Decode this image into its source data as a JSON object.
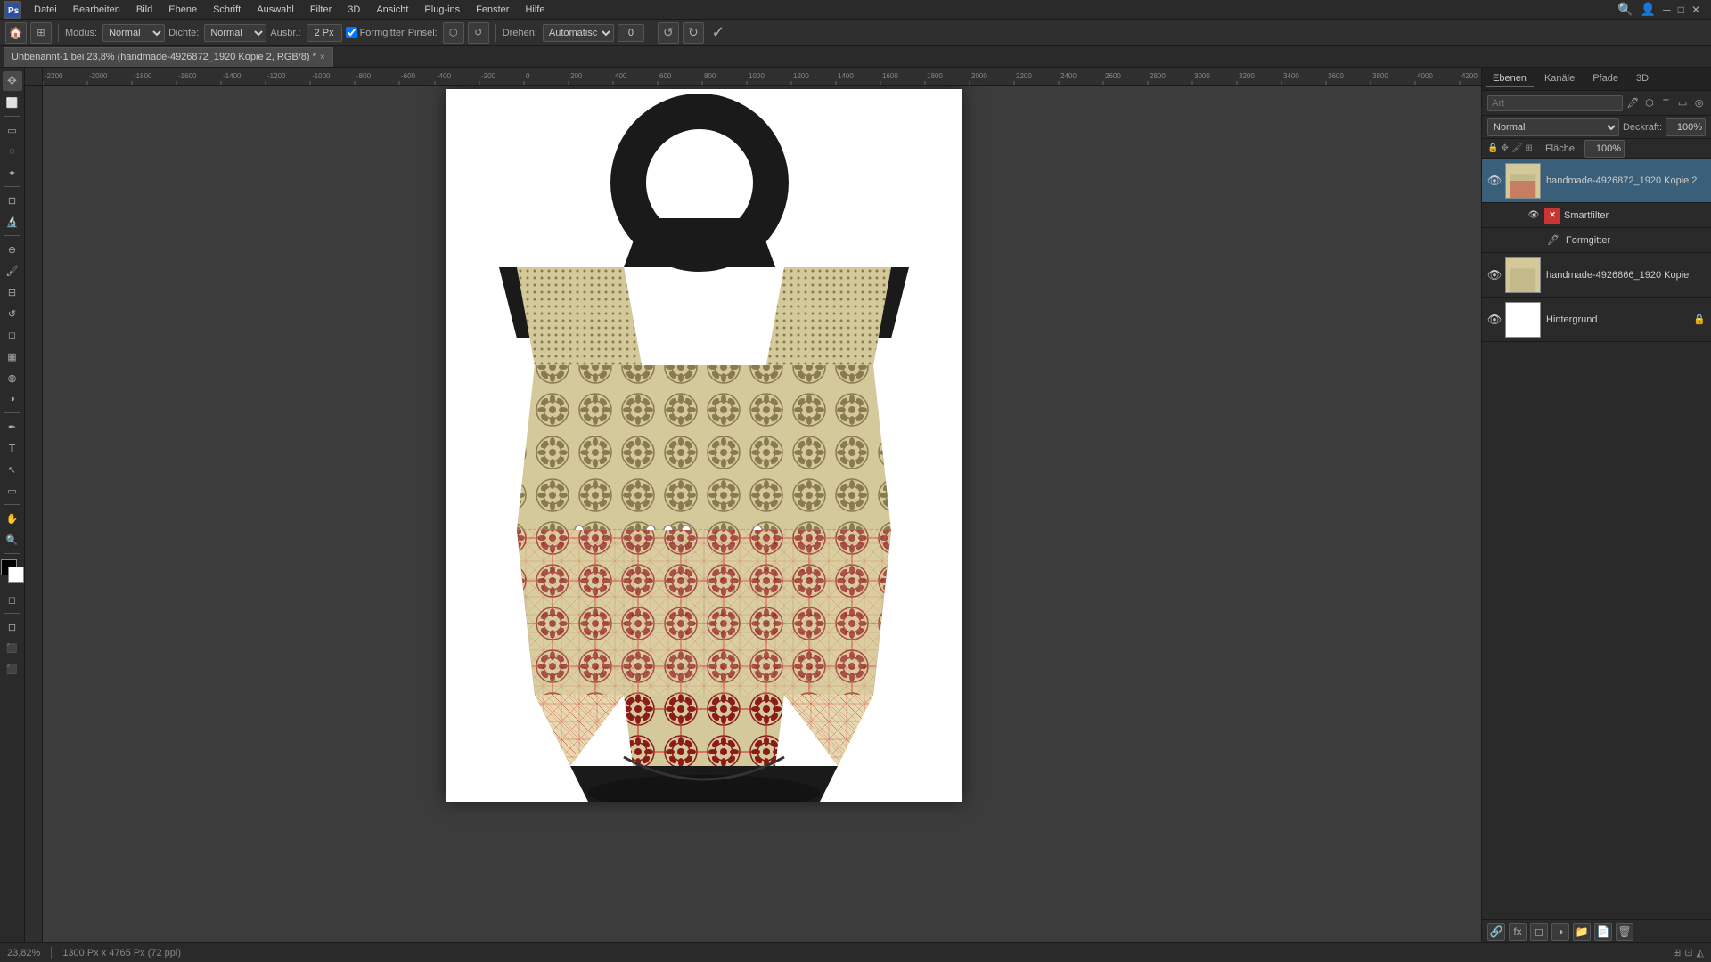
{
  "app": {
    "title": "Adobe Photoshop"
  },
  "menubar": {
    "items": [
      "Datei",
      "Bearbeiten",
      "Bild",
      "Ebene",
      "Schrift",
      "Auswahl",
      "Filter",
      "3D",
      "Ansicht",
      "Plug-ins",
      "Fenster",
      "Hilfe"
    ]
  },
  "toolbar": {
    "modus_label": "Modus:",
    "modus_value": "Normal",
    "dichte_label": "Dichte:",
    "dichte_value": "Normal",
    "ausbr_label": "Ausbr.:",
    "ausbr_value": "2 Px",
    "formgitter_label": "Formgitter",
    "pinsel_label": "Pinsel:",
    "drehen_label": "Drehen:",
    "drehen_value": "Automatisch",
    "angle_value": "0",
    "cancel_label": "↩",
    "confirm_label": "✓"
  },
  "tab": {
    "label": "Unbenannt-1 bei 23,8% (handmade-4926872_1920 Kopie 2, RGB/8) *",
    "close": "×"
  },
  "canvas": {
    "zoom": "23,82%",
    "size": "1300 Px x 4765 Px (72 ppi)"
  },
  "ruler": {
    "h_ticks": [
      "-2200",
      "-2000",
      "-1800",
      "-1600",
      "-1400",
      "-1200",
      "-1000",
      "-800",
      "-600",
      "-400",
      "-200",
      "0",
      "200",
      "400",
      "600",
      "800",
      "1000",
      "1200",
      "1400",
      "1600",
      "1800",
      "2000",
      "2200",
      "2400",
      "2600",
      "2800",
      "3000",
      "3200",
      "3400",
      "3600",
      "3800",
      "4000",
      "4200"
    ],
    "v_ticks": []
  },
  "right_panel": {
    "tabs": [
      "Ebenen",
      "Kanäle",
      "Pfade",
      "3D"
    ],
    "search_placeholder": "Art",
    "layer_mode": "Normal",
    "opacity_label": "Deckraft:",
    "opacity_value": "100%",
    "fill_label": "Fläche:",
    "fill_value": "100%",
    "layers": [
      {
        "id": "layer1",
        "name": "handmade-4926872_1920 Kopie 2",
        "visible": true,
        "selected": true,
        "has_lock": false,
        "thumb_bg": "#a8854a",
        "sub_layers": [
          {
            "id": "sl1",
            "name": "Smartfilter",
            "icon": "×"
          },
          {
            "id": "sl2",
            "name": "Formgitter",
            "icon": "🖊"
          }
        ]
      },
      {
        "id": "layer2",
        "name": "handmade-4926866_1920 Kopie",
        "visible": true,
        "selected": false,
        "has_lock": false,
        "thumb_bg": "#8b6a4a"
      },
      {
        "id": "layer3",
        "name": "Hintergrund",
        "visible": true,
        "selected": false,
        "has_lock": true,
        "thumb_bg": "#ffffff"
      }
    ]
  },
  "tools": {
    "left": [
      {
        "name": "move",
        "icon": "✥"
      },
      {
        "name": "artboard",
        "icon": "⬜"
      },
      {
        "name": "lasso",
        "icon": "⬡"
      },
      {
        "name": "brush",
        "icon": "🖌"
      },
      {
        "name": "clone",
        "icon": "⊕"
      },
      {
        "name": "eraser",
        "icon": "◻"
      },
      {
        "name": "gradient",
        "icon": "▦"
      },
      {
        "name": "dodge",
        "icon": "◍"
      },
      {
        "name": "pen",
        "icon": "✒"
      },
      {
        "name": "text",
        "icon": "T"
      },
      {
        "name": "path-select",
        "icon": "↖"
      },
      {
        "name": "shape",
        "icon": "◯"
      },
      {
        "name": "hand",
        "icon": "✋"
      },
      {
        "name": "zoom",
        "icon": "🔍"
      },
      {
        "name": "color",
        "icon": "■"
      },
      {
        "name": "mode",
        "icon": "◻"
      },
      {
        "name": "quick-mask",
        "icon": "◻"
      }
    ]
  },
  "statusbar": {
    "zoom": "23,82%",
    "size_info": "1300 Px x 4765 Px (72 ppi)"
  }
}
